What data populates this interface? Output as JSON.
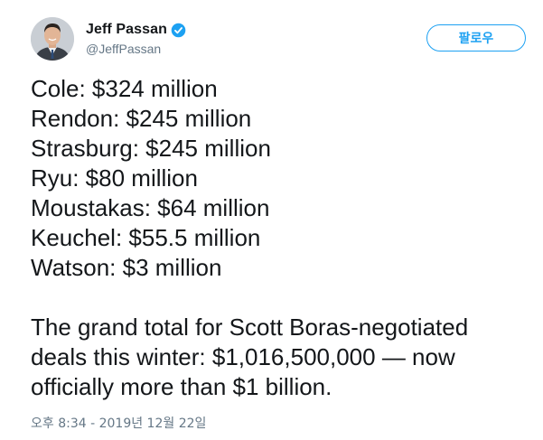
{
  "author": {
    "display_name": "Jeff Passan",
    "handle": "@JeffPassan",
    "verified": true,
    "avatar_icon": "profile-photo"
  },
  "follow_button": {
    "label": "팔로우",
    "color": "#1da1f2"
  },
  "tweet": {
    "lines": [
      "Cole: $324 million",
      "Rendon: $245 million",
      "Strasburg: $245 million",
      "Ryu: $80 million",
      "Moustakas: $64 million",
      "Keuchel: $55.5 million",
      "Watson: $3 million"
    ],
    "paragraph_lines": [
      "The grand total for Scott Boras-negotiated",
      "deals this winter: $1,016,500,000 — now",
      "officially more than $1 billion."
    ]
  },
  "timestamp": "오후 8:34 - 2019년 12월 22일"
}
